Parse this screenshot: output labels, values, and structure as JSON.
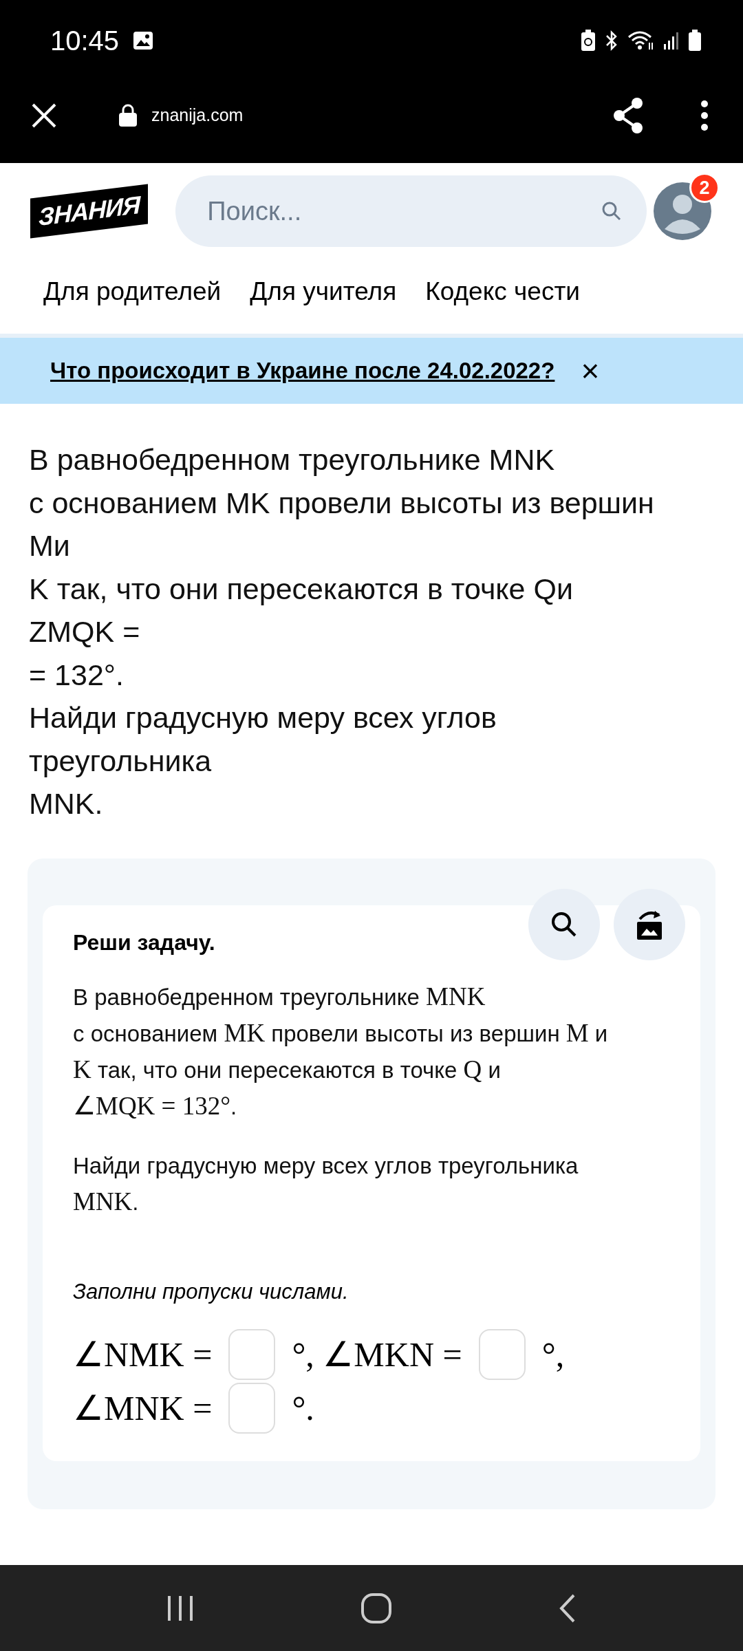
{
  "status_bar": {
    "time": "10:45"
  },
  "browser_bar": {
    "url": "znanija.com"
  },
  "header": {
    "logo": "ЗНАНИЯ",
    "search": {
      "placeholder": "Поиск..."
    },
    "notification_count": "2"
  },
  "nav_links": [
    "Для родителей",
    "Для учителя",
    "Кодекс чести"
  ],
  "banner": {
    "link": "Что происходит в Украине после 24.02.2022?",
    "close": "×"
  },
  "question_lines": [
    "В равнобедренном треугольнике MNK",
    "с основанием MK провели высоты из вершин",
    "Mи",
    "K так, что они пересекаются в точке Qи",
    "ZMQK =",
    "= 132°.",
    "Найди градусную меру всех углов",
    "треугольника",
    "MNK."
  ],
  "task_card": {
    "title": "Реши задачу.",
    "paragraphs": [
      [
        {
          "kind": "text",
          "text": "В равнобедренном треугольнике "
        },
        {
          "kind": "math",
          "text": "MNK"
        },
        {
          "kind": "break"
        },
        {
          "kind": "text",
          "text": "с основанием "
        },
        {
          "kind": "math",
          "text": "MK"
        },
        {
          "kind": "text",
          "text": " провели высоты из вершин "
        },
        {
          "kind": "math",
          "text": "M"
        },
        {
          "kind": "text",
          "text": " и"
        },
        {
          "kind": "break"
        },
        {
          "kind": "math",
          "text": "K"
        },
        {
          "kind": "text",
          "text": " так, что они пересекаются в точке "
        },
        {
          "kind": "math",
          "text": "Q"
        },
        {
          "kind": "text",
          "text": " и"
        },
        {
          "kind": "break"
        },
        {
          "kind": "math",
          "text": "∠MQK = 132°"
        },
        {
          "kind": "text",
          "text": "."
        }
      ],
      [
        {
          "kind": "text",
          "text": "Найди градусную меру всех углов треугольника"
        },
        {
          "kind": "break"
        },
        {
          "kind": "math",
          "text": "MNK"
        },
        {
          "kind": "text",
          "text": "."
        }
      ]
    ],
    "instruction": "Заполни пропуски числами.",
    "answer_rows": [
      [
        {
          "kind": "math",
          "text": "∠NMK ="
        },
        {
          "kind": "blank"
        },
        {
          "kind": "math",
          "text": "°, ∠MKN ="
        },
        {
          "kind": "blank"
        },
        {
          "kind": "math",
          "text": "°,"
        }
      ],
      [
        {
          "kind": "math",
          "text": "∠MNK ="
        },
        {
          "kind": "blank"
        },
        {
          "kind": "math",
          "text": "°."
        }
      ]
    ]
  }
}
